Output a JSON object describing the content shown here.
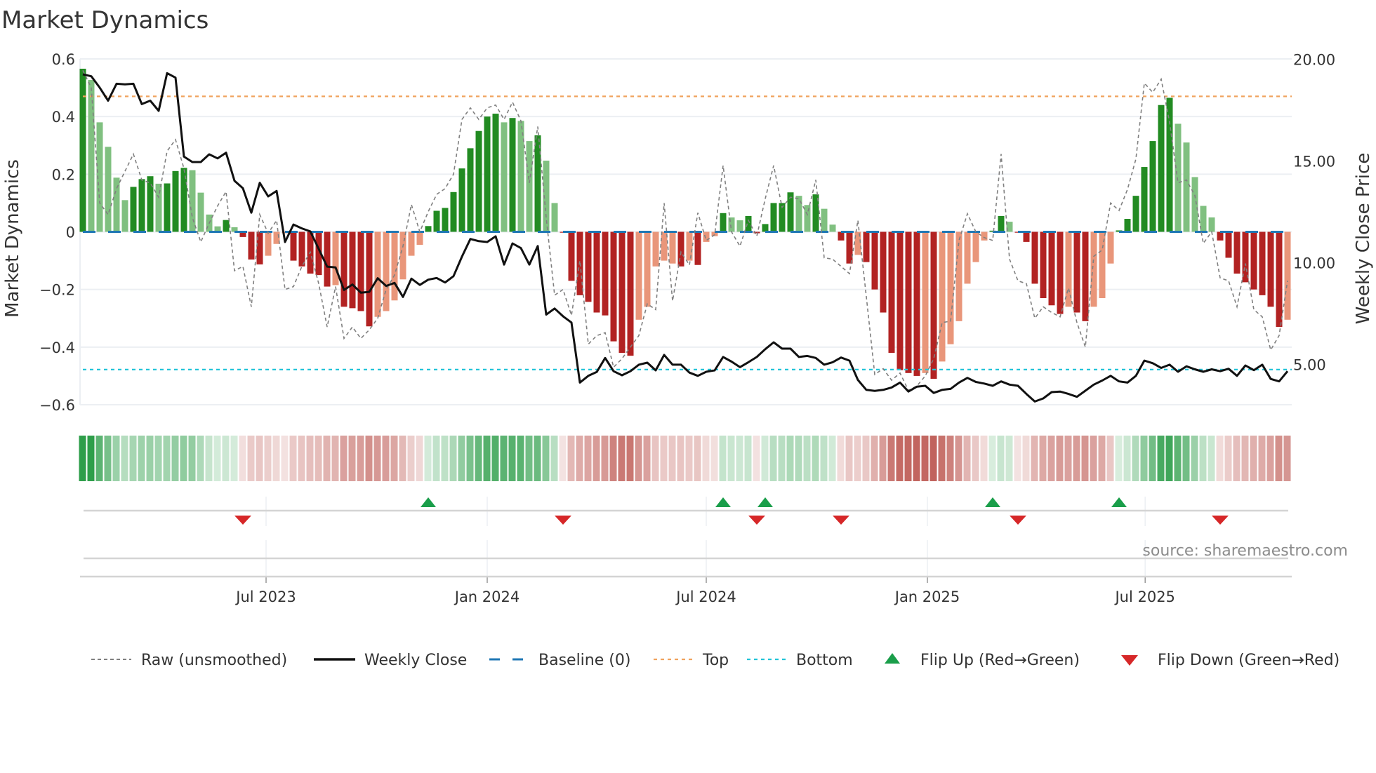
{
  "title": "Market Dynamics",
  "source": "source: sharemaestro.com",
  "colors": {
    "bar_pos_dark": "#228b22",
    "bar_pos_light": "#80c080",
    "bar_neg_dark": "#b22222",
    "bar_neg_light": "#e9967a",
    "raw": "#808080",
    "close": "#111111",
    "baseline": "#1f77b4",
    "top": "#f0a35e",
    "bottom": "#22c4d8",
    "flip_up": "#1a9e4a",
    "flip_down": "#d62728",
    "strip_green": "#2e9e4a",
    "strip_red": "#c0605a"
  },
  "legend": [
    {
      "key": "raw",
      "label": "Raw (unsmoothed)"
    },
    {
      "key": "close",
      "label": "Weekly Close"
    },
    {
      "key": "baseline",
      "label": "Baseline (0)"
    },
    {
      "key": "top",
      "label": "Top"
    },
    {
      "key": "bottom",
      "label": "Bottom"
    },
    {
      "key": "flip_up",
      "label": "Flip Up (Red→Green)"
    },
    {
      "key": "flip_down",
      "label": "Flip Down (Green→Red)"
    }
  ],
  "chart_data": {
    "type": "bar",
    "title": "Market Dynamics",
    "ylabel": "Market Dynamics",
    "y2label": "Weekly Close Price",
    "ylim": [
      -0.6,
      0.6
    ],
    "y2lim": [
      3.05,
      20.05
    ],
    "yticks": [
      {
        "v": 0.6,
        "label": "0.6"
      },
      {
        "v": 0.4,
        "label": "0.4"
      },
      {
        "v": 0.2,
        "label": "0.2"
      },
      {
        "v": 0,
        "label": "0"
      },
      {
        "v": -0.2,
        "label": "−0.2"
      },
      {
        "v": -0.4,
        "label": "−0.4"
      },
      {
        "v": -0.6,
        "label": "−0.6"
      }
    ],
    "y2ticks": [
      {
        "v": 20,
        "label": "20.00"
      },
      {
        "v": 15,
        "label": "15.00"
      },
      {
        "v": 10,
        "label": "10.00"
      },
      {
        "v": 5,
        "label": "5.00"
      }
    ],
    "xticks": [
      {
        "week": 21.75,
        "label": "Jul 2023"
      },
      {
        "week": 48.0,
        "label": "Jan 2024"
      },
      {
        "week": 74.0,
        "label": "Jul 2024"
      },
      {
        "week": 100.25,
        "label": "Jan 2025"
      },
      {
        "week": 126.1,
        "label": "Jul 2025"
      }
    ],
    "top_level": 0.47,
    "bottom_level": -0.478,
    "baseline": 0,
    "grid": true,
    "legend_position": "bottom",
    "dynamics": [
      0.566,
      0.527,
      0.38,
      0.295,
      0.188,
      0.11,
      0.156,
      0.183,
      0.193,
      0.167,
      0.168,
      0.211,
      0.222,
      0.214,
      0.136,
      0.06,
      0.019,
      0.041,
      0.016,
      -0.018,
      -0.096,
      -0.113,
      -0.083,
      -0.042,
      -0.005,
      -0.1,
      -0.12,
      -0.145,
      -0.15,
      -0.19,
      -0.185,
      -0.26,
      -0.265,
      -0.275,
      -0.328,
      -0.295,
      -0.275,
      -0.238,
      -0.165,
      -0.083,
      -0.045,
      0.02,
      0.073,
      0.083,
      0.138,
      0.22,
      0.29,
      0.35,
      0.4,
      0.41,
      0.38,
      0.395,
      0.385,
      0.315,
      0.335,
      0.247,
      0.1,
      -0.003,
      -0.17,
      -0.22,
      -0.243,
      -0.28,
      -0.29,
      -0.38,
      -0.42,
      -0.43,
      -0.305,
      -0.26,
      -0.12,
      -0.1,
      -0.11,
      -0.12,
      -0.1,
      -0.115,
      -0.035,
      -0.015,
      0.065,
      0.05,
      0.04,
      0.055,
      -0.005,
      0.027,
      0.1,
      0.1,
      0.137,
      0.125,
      0.093,
      0.13,
      0.08,
      0.025,
      -0.03,
      -0.11,
      -0.08,
      -0.105,
      -0.2,
      -0.28,
      -0.42,
      -0.48,
      -0.49,
      -0.5,
      -0.49,
      -0.51,
      -0.45,
      -0.39,
      -0.31,
      -0.18,
      -0.105,
      -0.03,
      0.004,
      0.055,
      0.035,
      -0.003,
      -0.035,
      -0.18,
      -0.23,
      -0.255,
      -0.285,
      -0.26,
      -0.28,
      -0.31,
      -0.26,
      -0.23,
      -0.11,
      0.005,
      0.045,
      0.125,
      0.225,
      0.315,
      0.44,
      0.465,
      0.375,
      0.31,
      0.19,
      0.09,
      0.05,
      -0.03,
      -0.09,
      -0.145,
      -0.175,
      -0.2,
      -0.22,
      -0.26,
      -0.33,
      -0.305
    ],
    "shade": "DLLLLLDDDLDDDLLLLDLDDDLLLDDDDDLDDDDLLLLLLDDDDDDDDDLDLLDLLDDDDDDDDDLLLLLDLDLLDLLDDDDDDLLDLLDDLDDDDDDDLDLLLLLLDDLDDDDDDLDDLLLDDDDDDDLLLLLDDDDDDDDL",
    "raw": [
      0.56,
      0.5,
      0.1,
      0.06,
      0.15,
      0.21,
      0.27,
      0.18,
      0.17,
      0.12,
      0.28,
      0.32,
      0.22,
      0.05,
      -0.035,
      0.03,
      0.09,
      0.14,
      -0.135,
      -0.12,
      -0.26,
      0.06,
      -0.005,
      0.04,
      -0.2,
      -0.19,
      -0.12,
      -0.07,
      -0.18,
      -0.33,
      -0.19,
      -0.37,
      -0.33,
      -0.37,
      -0.34,
      -0.3,
      -0.2,
      -0.15,
      -0.05,
      0.095,
      0.0,
      0.07,
      0.13,
      0.15,
      0.2,
      0.39,
      0.43,
      0.39,
      0.43,
      0.44,
      0.39,
      0.45,
      0.385,
      0.17,
      0.365,
      0.05,
      -0.22,
      -0.2,
      -0.29,
      -0.1,
      -0.39,
      -0.36,
      -0.35,
      -0.47,
      -0.44,
      -0.4,
      -0.36,
      -0.25,
      -0.27,
      0.1,
      -0.24,
      -0.07,
      -0.115,
      0.066,
      -0.03,
      -0.01,
      0.23,
      0,
      -0.05,
      0.04,
      -0.015,
      0.115,
      0.23,
      0.085,
      0.12,
      0.115,
      0.06,
      0.18,
      -0.09,
      -0.095,
      -0.12,
      -0.145,
      0.04,
      -0.225,
      -0.495,
      -0.475,
      -0.515,
      -0.49,
      -0.55,
      -0.535,
      -0.5,
      -0.44,
      -0.315,
      -0.31,
      -0.03,
      0.063,
      0,
      -0.02,
      -0.03,
      0.27,
      -0.095,
      -0.17,
      -0.18,
      -0.3,
      -0.26,
      -0.28,
      -0.295,
      -0.195,
      -0.315,
      -0.4,
      -0.085,
      -0.063,
      0.1,
      0.074,
      0.147,
      0.253,
      0.516,
      0.484,
      0.53,
      0.38,
      0.17,
      0.18,
      0.126,
      -0.04,
      0,
      -0.16,
      -0.17,
      -0.26,
      -0.11,
      -0.27,
      -0.295,
      -0.41,
      -0.36,
      -0.17
    ],
    "close": [
      19.29,
      19.2,
      18.64,
      18.0,
      18.83,
      18.8,
      18.83,
      17.83,
      18.0,
      17.5,
      19.35,
      19.13,
      15.25,
      14.98,
      14.98,
      15.36,
      15.16,
      15.44,
      14.06,
      13.69,
      12.49,
      13.96,
      13.29,
      13.56,
      11.05,
      11.91,
      11.72,
      11.57,
      10.71,
      9.84,
      9.8,
      8.69,
      8.96,
      8.56,
      8.6,
      9.27,
      8.89,
      9.04,
      8.35,
      9.25,
      8.94,
      9.2,
      9.28,
      9.06,
      9.37,
      10.33,
      11.2,
      11.09,
      11.05,
      11.33,
      9.94,
      10.98,
      10.75,
      9.94,
      10.85,
      7.48,
      7.78,
      7.4,
      7.09,
      4.14,
      4.47,
      4.66,
      5.35,
      4.7,
      4.5,
      4.7,
      5.02,
      5.12,
      4.74,
      5.5,
      5.02,
      5.02,
      4.63,
      4.47,
      4.67,
      4.74,
      5.4,
      5.17,
      4.9,
      5.14,
      5.4,
      5.78,
      6.12,
      5.81,
      5.81,
      5.4,
      5.45,
      5.35,
      5.02,
      5.14,
      5.37,
      5.22,
      4.27,
      3.78,
      3.73,
      3.78,
      3.9,
      4.14,
      3.7,
      3.94,
      3.98,
      3.63,
      3.78,
      3.83,
      4.14,
      4.37,
      4.17,
      4.09,
      3.98,
      4.2,
      4.04,
      3.98,
      3.58,
      3.21,
      3.36,
      3.67,
      3.7,
      3.58,
      3.44,
      3.74,
      4.04,
      4.24,
      4.47,
      4.2,
      4.14,
      4.47,
      5.22,
      5.09,
      4.86,
      5.02,
      4.67,
      4.94,
      4.79,
      4.67,
      4.79,
      4.7,
      4.82,
      4.47,
      4.98,
      4.75,
      5.02,
      4.32,
      4.2,
      4.7
    ],
    "flip_up_weeks": [
      41,
      76,
      81,
      108,
      123
    ],
    "flip_down_weeks": [
      19,
      57,
      80,
      90,
      111,
      135
    ]
  }
}
